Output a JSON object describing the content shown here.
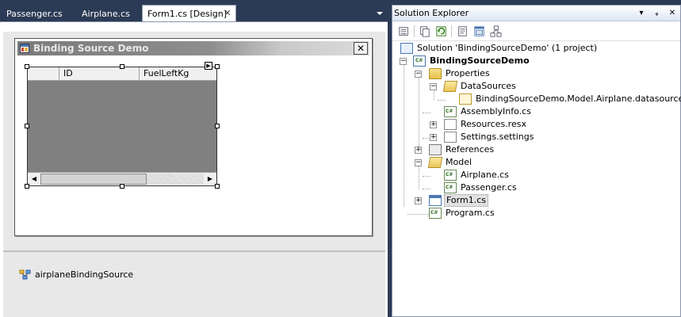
{
  "editor": {
    "tabs": [
      {
        "label": "Passenger.cs"
      },
      {
        "label": "Airplane.cs"
      },
      {
        "label": "Form1.cs [Design]"
      }
    ],
    "close_glyph": "✕"
  },
  "form": {
    "title": "Binding Source Demo",
    "close_glyph": "✕",
    "grid": {
      "columns": [
        "ID",
        "FuelLeftKg"
      ]
    }
  },
  "tray": {
    "item_label": "airplaneBindingSource"
  },
  "solution_explorer": {
    "title": "Solution Explorer",
    "title_buttons": [
      "▾",
      "ᵩ",
      "✕"
    ],
    "tree": [
      {
        "label": "Solution 'BindingSourceDemo' (1 project)",
        "icon": "solution-icon"
      },
      {
        "label": "BindingSourceDemo",
        "icon": "csharp-project-icon"
      },
      {
        "label": "Properties",
        "icon": "folder-icon"
      },
      {
        "label": "DataSources",
        "icon": "folder-open-icon"
      },
      {
        "label": "BindingSourceDemo.Model.Airplane.datasource",
        "icon": "datasource-icon"
      },
      {
        "label": "AssemblyInfo.cs",
        "icon": "csharp-file-icon"
      },
      {
        "label": "Resources.resx",
        "icon": "resx-icon"
      },
      {
        "label": "Settings.settings",
        "icon": "settings-icon"
      },
      {
        "label": "References",
        "icon": "references-icon"
      },
      {
        "label": "Model",
        "icon": "folder-open-icon"
      },
      {
        "label": "Airplane.cs",
        "icon": "csharp-file-icon"
      },
      {
        "label": "Passenger.cs",
        "icon": "csharp-file-icon"
      },
      {
        "label": "Form1.cs",
        "icon": "form-icon"
      },
      {
        "label": "Program.cs",
        "icon": "csharp-file-icon"
      }
    ],
    "expander_plus": "+",
    "expander_minus": "−"
  }
}
